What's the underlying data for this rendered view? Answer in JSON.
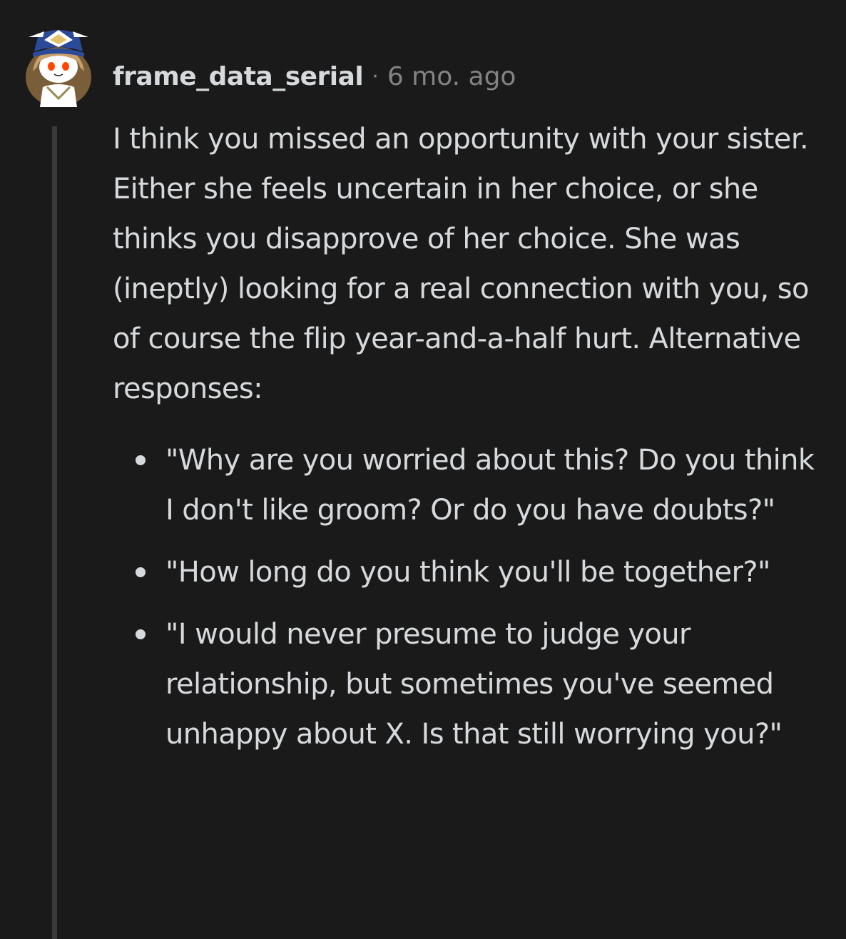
{
  "comment": {
    "author": "frame_data_serial",
    "separator": "·",
    "timestamp": "6 mo. ago",
    "avatar_icon": "snoo-avatar-captain-hat-icon",
    "paragraph": "I think you missed an opportunity with your sister. Either she feels uncertain in her choice, or she thinks you disapprove of her choice. She was (ineptly) looking for a real connection with you, so of course the flip year-and-a-half hurt. Alternative responses:",
    "bullets": [
      "\"Why are you worried about this? Do you think I don't like groom? Or do you have doubts?\"",
      "\"How long do you think you'll be together?\"",
      "\"I would never presume to judge your relationship, but sometimes you've seemed unhappy about X. Is that still worrying you?\""
    ]
  },
  "colors": {
    "background": "#1a1a1b",
    "text": "#d7dadc",
    "muted": "#818384",
    "thread_line": "#3a3a3c"
  }
}
